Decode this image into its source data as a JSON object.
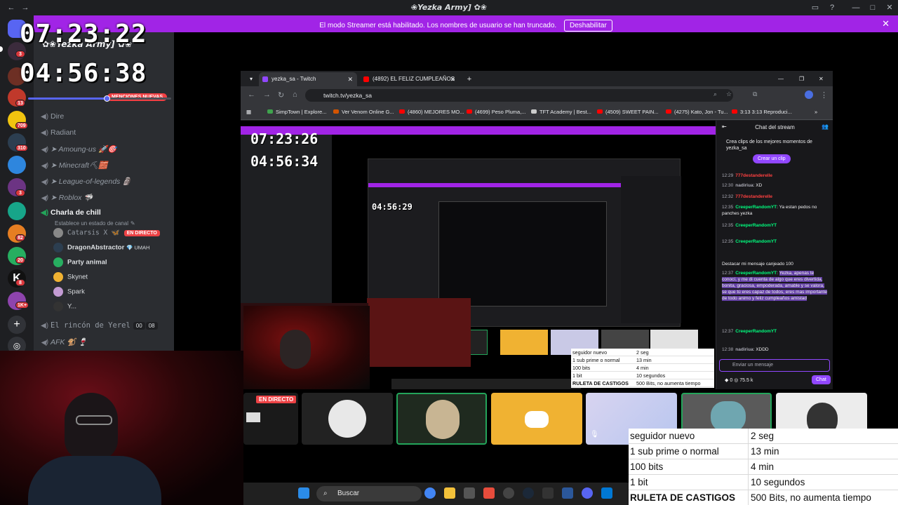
{
  "window": {
    "title": "❀̶Yezka Army] ✿❀"
  },
  "banner": {
    "message": "El modo Streamer está habilitado. Los nombres de usuario se han truncado.",
    "disable_label": "Deshabilitar"
  },
  "overlay": {
    "timer_top": "07:23:22",
    "timer_bottom": "04:56:38"
  },
  "server": {
    "name": "✿❀Yezka Army] ✿❀",
    "mentions_label": "MENCIONES NUEVAS",
    "channels": [
      {
        "label": "Dire"
      },
      {
        "label": "Radiant"
      },
      {
        "label": "Amoung-us 🚀🎯"
      },
      {
        "label": "Minecraft⛏🧱"
      },
      {
        "label": "League-of-legends 🗿"
      },
      {
        "label": "Roblox 🦈"
      },
      {
        "label": "Charla de chill",
        "status_hint": "Establece un estado de canal"
      },
      {
        "label": "El rincón de Yerel",
        "count_a": "00",
        "count_b": "08"
      },
      {
        "label": "AFK 🐒 🍷"
      }
    ],
    "members": [
      {
        "name": "Catarsis X 🦋",
        "live_label": "EN DIRECTO"
      },
      {
        "name": "DragonAbstractor",
        "tag": "💎 UMAH"
      },
      {
        "name": "Party animal"
      },
      {
        "name": "Skynet"
      },
      {
        "name": "Spark"
      },
      {
        "name": "Y..."
      }
    ],
    "badges": [
      "3",
      "13",
      "709",
      "310",
      "3",
      "82",
      "20",
      "8",
      "1K+"
    ],
    "volume_level": 0.55
  },
  "browser": {
    "tabs": [
      {
        "title": "yezka_sa - Twitch",
        "active": true
      },
      {
        "title": "(4892) EL FELIZ CUMPLEAÑOS",
        "active": false
      }
    ],
    "url": "twitch.tv/yezka_sa",
    "bookmarks": [
      "SimpTown | Explore...",
      "Ver Venom Online G...",
      "(4860) MEJORES MO...",
      "(4699) Peso Pluma,...",
      "TFT Academy | Best...",
      "(4509) SWEET PAIN...",
      "(4275) Kato, Jon - Tu...",
      "3:13 3:13 Reproduci..."
    ],
    "nested_timer_top": "07:23:26",
    "nested_timer_bottom": "04:56:34",
    "nested_timer_mid": "04:56:29"
  },
  "twitch_chat": {
    "header": "Chat del stream",
    "clip_prompt": "Crea clips de los mejores momentos de yezka_sa",
    "clip_button": "Crear un clip",
    "messages": [
      {
        "time": "12:29",
        "user": "777destanderelle",
        "text": "",
        "user_color": "red"
      },
      {
        "time": "12:30",
        "user": "nadiriua",
        "text": "XD",
        "user_color": "gray"
      },
      {
        "time": "12:32",
        "user": "777destanderelle",
        "text": "",
        "user_color": "red"
      },
      {
        "time": "12:35",
        "user": "CreeperRandomYT",
        "text": "Ya estan pedos no panches yezka",
        "user_color": "green"
      },
      {
        "time": "12:35",
        "user": "CreeperRandomYT",
        "text": "",
        "user_color": "green"
      },
      {
        "time": "12:35",
        "user": "CreeperRandomYT",
        "text": "",
        "user_color": "green"
      },
      {
        "time": "",
        "user": "",
        "text": "Destacar mi mensaje canjeado  100",
        "user_color": "gray"
      },
      {
        "time": "12:37",
        "user": "CreeperRandomYT",
        "text": "Yezka, apenas te conocí, y me di cuenta de algo que eres divertida, bonita, graciosa, empoderada, amable y se valora, se que tú eres capaz de todos, eres mas importante de todo animo y feliz cumpleaños amistad",
        "user_color": "green"
      },
      {
        "time": "12:37",
        "user": "CreeperRandomYT",
        "text": "",
        "user_color": "green"
      },
      {
        "time": "12:38",
        "user": "nadiriua",
        "text": "XDDD",
        "user_color": "gray"
      }
    ],
    "input_placeholder": "Enviar un mensaje",
    "points": "75.5 k",
    "points_zero": "0",
    "chat_button": "Chat"
  },
  "stream": {
    "live_label": "EN DIRECTO"
  },
  "rules": [
    {
      "trigger": "seguidor nuevo",
      "penalty": "2 seg"
    },
    {
      "trigger": "1 sub prime o normal",
      "penalty": "13 min"
    },
    {
      "trigger": "100 bits",
      "penalty": "4 min"
    },
    {
      "trigger": "1 bit",
      "penalty": "10 segundos"
    },
    {
      "trigger": "RULETA DE CASTIGOS",
      "penalty": "500 Bits, no aumenta tiempo"
    }
  ],
  "mini_rules": [
    {
      "trigger": "seguidor nuevo",
      "penalty": "2 seg"
    },
    {
      "trigger": "1 sub prime o normal",
      "penalty": "13 min"
    },
    {
      "trigger": "100 bits",
      "penalty": "4 min"
    },
    {
      "trigger": "1 bit",
      "penalty": "10 segundos"
    },
    {
      "trigger": "RULETA DE CASTIGOS",
      "penalty": "500 Bits, no aumenta tiempo"
    }
  ],
  "taskbar": {
    "search_label": "Buscar"
  },
  "colors": {
    "streamer_banner": "#a124e6",
    "discord_blurple": "#5865f2",
    "twitch_purple": "#9147ff",
    "live_red": "#ed4245",
    "discord_tile": "#f0b232",
    "voice_green": "#23a55a"
  }
}
